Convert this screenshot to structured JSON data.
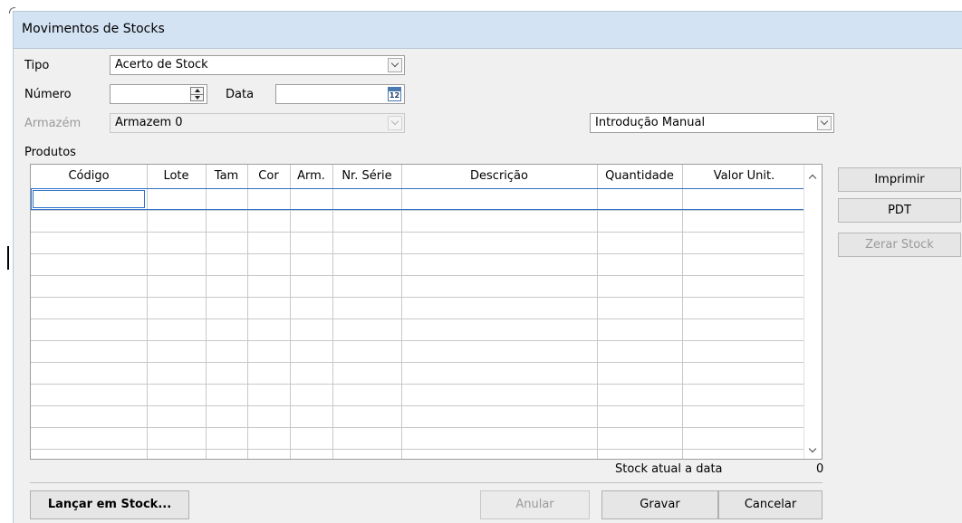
{
  "window": {
    "title": "Movimentos de Stocks"
  },
  "form": {
    "tipo_label": "Tipo",
    "tipo_value": "Acerto de Stock",
    "numero_label": "Número",
    "numero_value": "",
    "data_label": "Data",
    "data_value": "",
    "calendar_day": "12",
    "armazem_label": "Armazém",
    "armazem_value": "Armazem 0",
    "modo_value": "Introdução Manual"
  },
  "grid": {
    "section_label": "Produtos",
    "columns": [
      "Código",
      "Lote",
      "Tam",
      "Cor",
      "Arm.",
      "Nr. Série",
      "Descrição",
      "Quantidade",
      "Valor Unit."
    ],
    "rows": []
  },
  "side_buttons": {
    "imprimir": "Imprimir",
    "pdt": "PDT",
    "zerar": "Zerar Stock"
  },
  "status": {
    "stock_label": "Stock atual a data",
    "stock_value": "0"
  },
  "buttons": {
    "lancar": "Lançar em Stock...",
    "anular": "Anular",
    "gravar": "Gravar",
    "cancelar": "Cancelar"
  },
  "colors": {
    "titlebar": "#d4e3f4",
    "selection": "#2f72c9",
    "window_bg": "#f0f0f0"
  }
}
